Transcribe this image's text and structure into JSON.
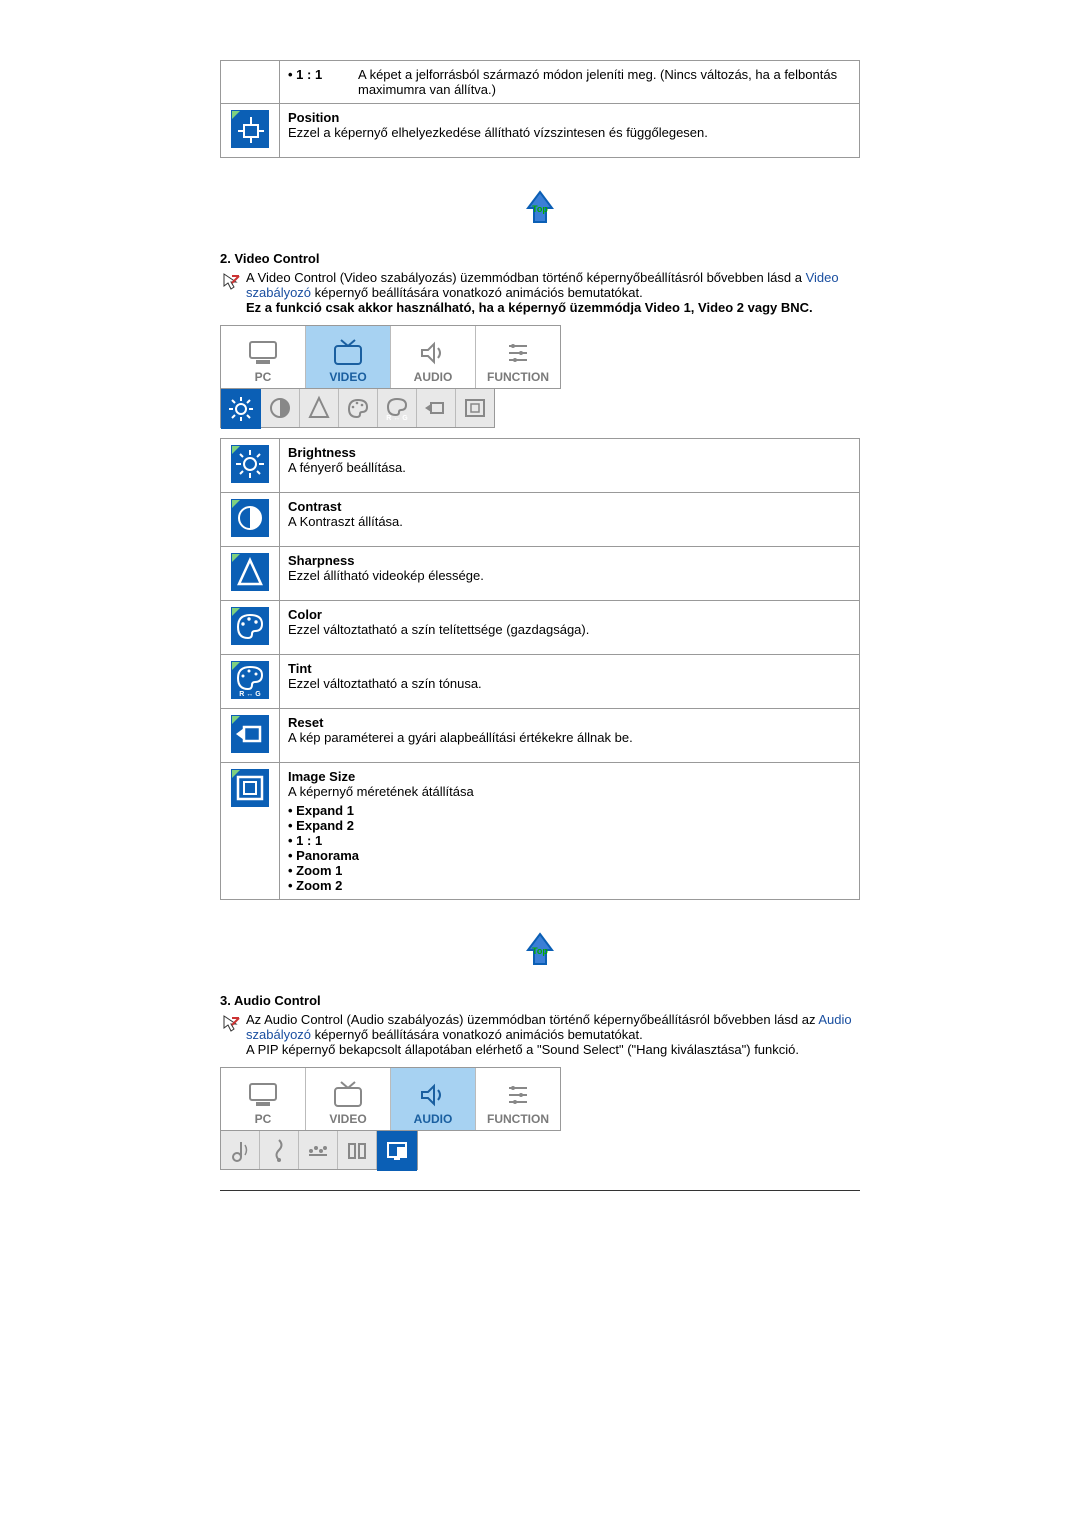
{
  "row1": {
    "bullet": "1 : 1",
    "text": "A képet a jelforrásból származó módon jeleníti meg. (Nincs változás, ha a felbontás maximumra van állítva.)"
  },
  "row2": {
    "title": "Position",
    "text": "Ezzel a képernyő elhelyezkedése állítható vízszintesen és függőlegesen."
  },
  "sec2": {
    "heading": "2. Video Control",
    "p1a": "A Video Control (Video szabályozás) üzemmódban történő képernyőbeállításról bővebben lásd a ",
    "p1link": "Video szabályozó",
    "p1b": " képernyő beállítására vonatkozó animációs bemutatókat.",
    "p2": "Ez a funkció csak akkor használható, ha a képernyő üzemmódja Video 1, Video 2 vagy BNC."
  },
  "tabs": {
    "pc": "PC",
    "video": "VIDEO",
    "audio": "AUDIO",
    "func": "FUNCTION"
  },
  "items": {
    "brightness": {
      "t": "Brightness",
      "d": "A fényerő beállítása."
    },
    "contrast": {
      "t": "Contrast",
      "d": "A Kontraszt állítása."
    },
    "sharpness": {
      "t": "Sharpness",
      "d": "Ezzel állítható videokép élessége."
    },
    "color": {
      "t": "Color",
      "d": "Ezzel változtatható a szín telítettsége (gazdagsága)."
    },
    "tint": {
      "t": "Tint",
      "d": "Ezzel változtatható a szín tónusa."
    },
    "reset": {
      "t": "Reset",
      "d": "A kép paraméterei a gyári alapbeállítási értékekre állnak be."
    },
    "imagesize": {
      "t": "Image Size",
      "d": "A képernyő méretének átállítása",
      "o1": "Expand 1",
      "o2": "Expand 2",
      "o3": "1 : 1",
      "o4": "Panorama",
      "o5": "Zoom 1",
      "o6": "Zoom 2"
    }
  },
  "sec3": {
    "heading": "3. Audio Control",
    "p1a": "Az Audio Control (Audio szabályozás) üzemmódban történő képernyőbeállításról bővebben lásd az ",
    "p1link": "Audio szabályozó",
    "p1b": " képernyő beállítására vonatkozó animációs bemutatókat.",
    "p2": "A PIP képernyő bekapcsolt állapotában elérhető a \"Sound Select\" (\"Hang kiválasztása\") funkció."
  }
}
